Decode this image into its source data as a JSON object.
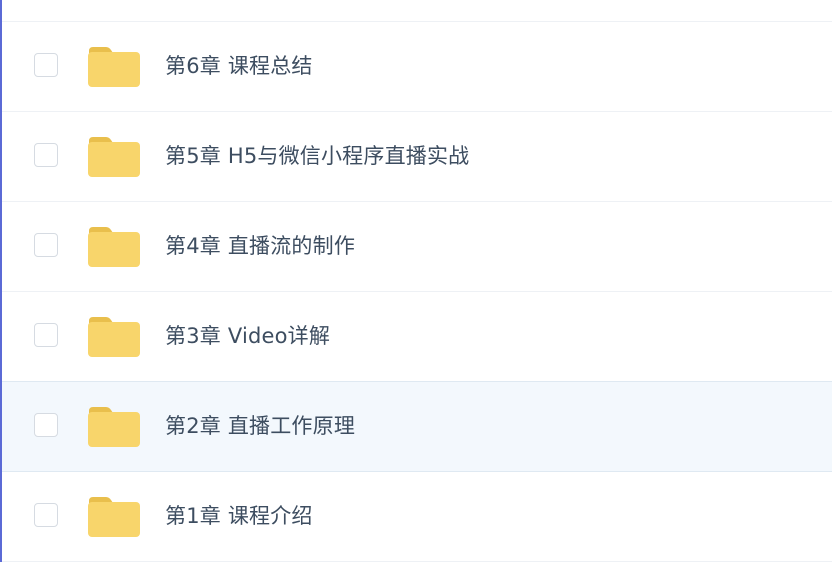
{
  "colors": {
    "accent_edge": "#5b6ad6",
    "folder_body": "#f8d56b",
    "folder_tab": "#e9bf4c",
    "text": "#3d4d60",
    "hover_row": "#f3f8fd"
  },
  "file_list": {
    "items": [
      {
        "name": "",
        "icon": "folder-icon",
        "checked": false,
        "hovered": false
      },
      {
        "name": "第6章 课程总结",
        "icon": "folder-icon",
        "checked": false,
        "hovered": false
      },
      {
        "name": "第5章 H5与微信小程序直播实战",
        "icon": "folder-icon",
        "checked": false,
        "hovered": false
      },
      {
        "name": "第4章 直播流的制作",
        "icon": "folder-icon",
        "checked": false,
        "hovered": false
      },
      {
        "name": "第3章 Video详解",
        "icon": "folder-icon",
        "checked": false,
        "hovered": false
      },
      {
        "name": "第2章 直播工作原理",
        "icon": "folder-icon",
        "checked": false,
        "hovered": true
      },
      {
        "name": "第1章 课程介绍",
        "icon": "folder-icon",
        "checked": false,
        "hovered": false
      }
    ]
  }
}
